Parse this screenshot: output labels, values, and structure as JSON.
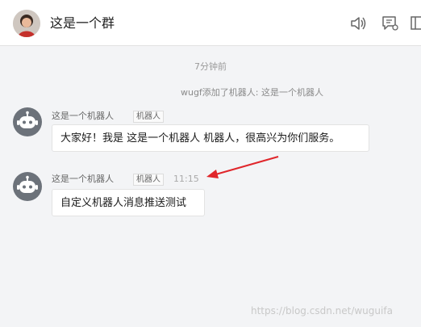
{
  "header": {
    "title": "这是一个群",
    "icons": [
      "speaker-icon",
      "message-settings-icon",
      "layout-icon"
    ]
  },
  "chat": {
    "time_divider": "7分钟前",
    "system_message": "wugf添加了机器人: 这是一个机器人",
    "messages": [
      {
        "sender": "这是一个机器人",
        "tag": "机器人",
        "time": "",
        "text": "大家好！我是 这是一个机器人 机器人，很高兴为你们服务。"
      },
      {
        "sender": "这是一个机器人",
        "tag": "机器人",
        "time": "11:15",
        "text": "自定义机器人消息推送测试"
      }
    ]
  },
  "colors": {
    "annotation_arrow": "#e0262b",
    "robot_avatar_bg": "#6c727a"
  },
  "watermark": "https://blog.csdn.net/wuguifa"
}
